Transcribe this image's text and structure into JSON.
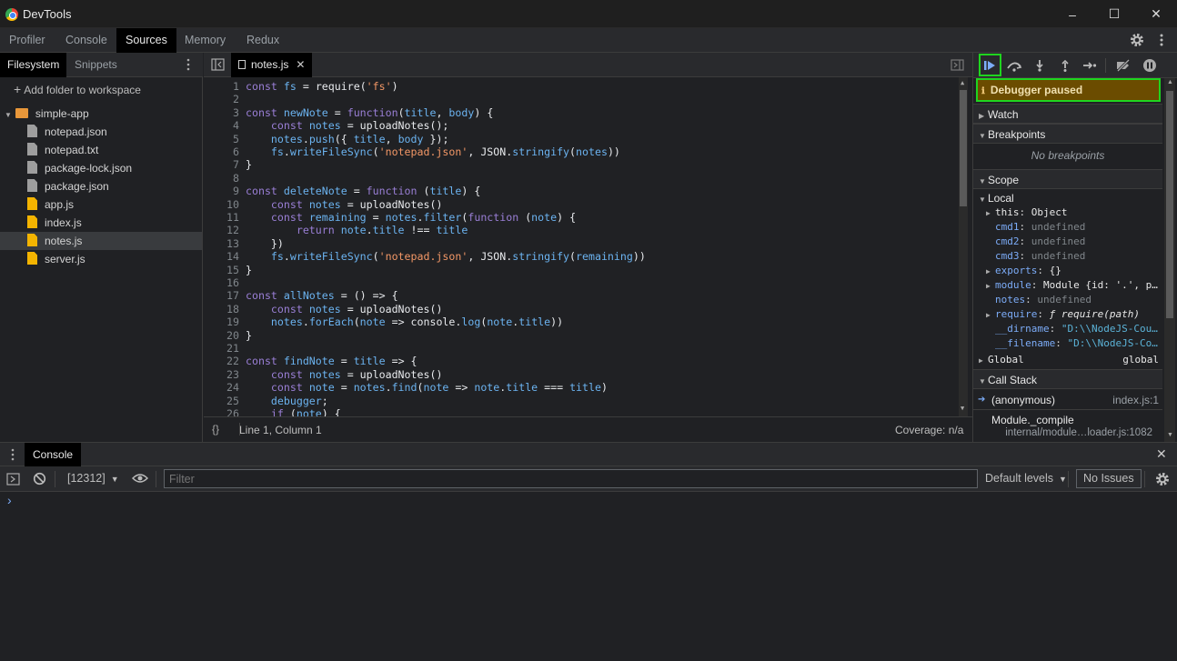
{
  "window": {
    "title": "DevTools",
    "controls": [
      "–",
      "☐",
      "✕"
    ]
  },
  "main_tabs": [
    {
      "label": "Profiler"
    },
    {
      "label": "Console"
    },
    {
      "label": "Sources",
      "active": true
    },
    {
      "label": "Memory"
    },
    {
      "label": "Redux"
    }
  ],
  "navigator": {
    "tabs": [
      {
        "label": "Filesystem",
        "active": true
      },
      {
        "label": "Snippets"
      }
    ],
    "add_folder": "Add folder to workspace",
    "root": "simple-app",
    "files": [
      {
        "name": "notepad.json",
        "icon": "gray"
      },
      {
        "name": "notepad.txt",
        "icon": "gray"
      },
      {
        "name": "package-lock.json",
        "icon": "gray"
      },
      {
        "name": "package.json",
        "icon": "gray"
      },
      {
        "name": "app.js",
        "icon": "yellow"
      },
      {
        "name": "index.js",
        "icon": "yellow"
      },
      {
        "name": "notes.js",
        "icon": "yellow",
        "selected": true
      },
      {
        "name": "server.js",
        "icon": "yellow"
      }
    ]
  },
  "editor": {
    "tab": "notes.js",
    "status_position": "Line 1, Column 1",
    "coverage": "Coverage: n/a",
    "lines": [
      "const fs = require('fs')",
      "",
      "const newNote = function(title, body) {",
      "    const notes = uploadNotes();",
      "    notes.push({ title, body });",
      "    fs.writeFileSync('notepad.json', JSON.stringify(notes))",
      "}",
      "",
      "const deleteNote = function (title) {",
      "    const notes = uploadNotes()",
      "    const remaining = notes.filter(function (note) {",
      "        return note.title !== title",
      "    })",
      "    fs.writeFileSync('notepad.json', JSON.stringify(remaining))",
      "}",
      "",
      "const allNotes = () => {",
      "    const notes = uploadNotes()",
      "    notes.forEach(note => console.log(note.title))",
      "}",
      "",
      "const findNote = title => {",
      "    const notes = uploadNotes()",
      "    const note = notes.find(note => note.title === title)",
      "    debugger;",
      "    if (note) {"
    ]
  },
  "debugger": {
    "paused_label": "Debugger paused",
    "watch": "Watch",
    "breakpoints": "Breakpoints",
    "no_breakpoints": "No breakpoints",
    "scope": "Scope",
    "local": "Local",
    "scope_items": [
      {
        "key": "this",
        "value": "Object",
        "expandable": true
      },
      {
        "key": "cmd1",
        "value": "undefined"
      },
      {
        "key": "cmd2",
        "value": "undefined"
      },
      {
        "key": "cmd3",
        "value": "undefined"
      },
      {
        "key": "exports",
        "value": "{}",
        "expandable": true
      },
      {
        "key": "module",
        "value": "Module {id: '.', p…",
        "expandable": true
      },
      {
        "key": "notes",
        "value": "undefined"
      },
      {
        "key": "require",
        "value": "ƒ require(path)",
        "expandable": true
      },
      {
        "key": "__dirname",
        "value": "\"D:\\\\NodeJS-Cou…"
      },
      {
        "key": "__filename",
        "value": "\"D:\\\\NodeJS-Co…"
      }
    ],
    "global_label": "Global",
    "global_value": "global",
    "call_stack": "Call Stack",
    "frames": [
      {
        "name": "(anonymous)",
        "location": "index.js:1",
        "current": true
      },
      {
        "name": "Module._compile",
        "location": "internal/module…loader.js:1082"
      }
    ],
    "highlight_color": "#1fd41f"
  },
  "console": {
    "tab": "Console",
    "context": "[12312]",
    "filter_placeholder": "Filter",
    "levels": "Default levels",
    "issues": "No Issues",
    "prompt": "›"
  }
}
